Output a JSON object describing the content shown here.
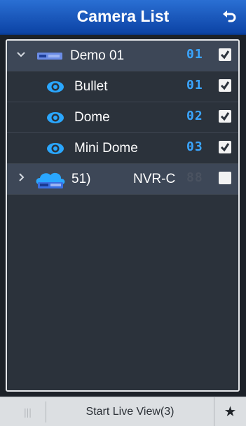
{
  "header": {
    "title": "Camera List"
  },
  "tree": {
    "root": {
      "label": "Demo 01",
      "number": "01",
      "checked": true
    },
    "cameras": [
      {
        "label": "Bullet",
        "number": "01",
        "checked": true
      },
      {
        "label": "Dome",
        "number": "02",
        "checked": true
      },
      {
        "label": "Mini Dome",
        "number": "03",
        "checked": true
      }
    ],
    "nvr": {
      "label_left": "51)",
      "label_right": "NVR-C",
      "number": "88",
      "checked": false
    }
  },
  "footer": {
    "grip": "|||",
    "live_label": "Start Live View(3)",
    "fav_label": "★"
  }
}
